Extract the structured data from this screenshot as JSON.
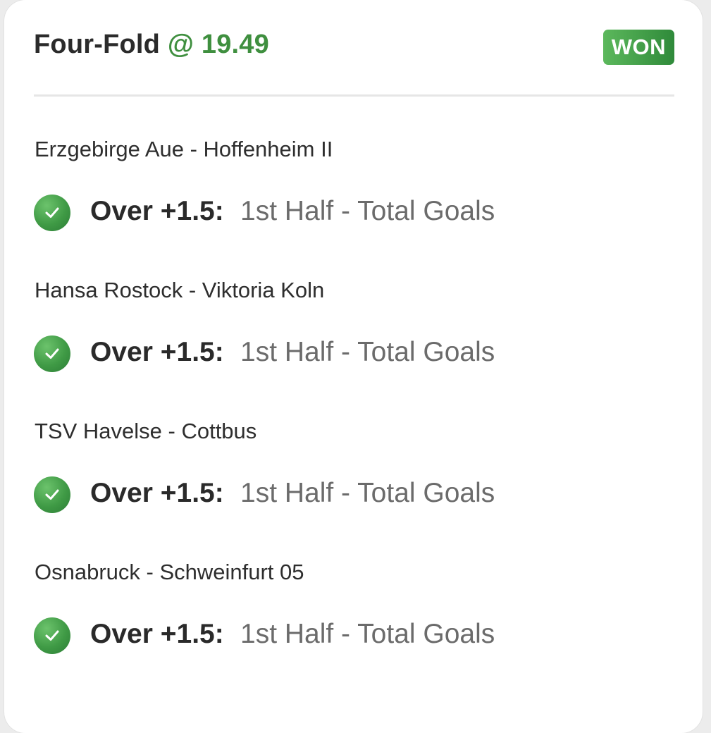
{
  "bet": {
    "title": "Four-Fold",
    "odds": "@ 19.49",
    "status": "WON"
  },
  "legs": [
    {
      "match": "Erzgebirge Aue - Hoffenheim II",
      "pick": "Over +1.5:",
      "market": "1st Half - Total Goals"
    },
    {
      "match": "Hansa Rostock - Viktoria Koln",
      "pick": "Over +1.5:",
      "market": "1st Half - Total Goals"
    },
    {
      "match": "TSV Havelse - Cottbus",
      "pick": "Over +1.5:",
      "market": "1st Half - Total Goals"
    },
    {
      "match": "Osnabruck - Schweinfurt 05",
      "pick": "Over +1.5:",
      "market": "1st Half - Total Goals"
    }
  ],
  "icons": {
    "leg_result": "check-circle-icon"
  },
  "colors": {
    "accent_green": "#3f8f3f",
    "badge_green": "#4caf50"
  }
}
